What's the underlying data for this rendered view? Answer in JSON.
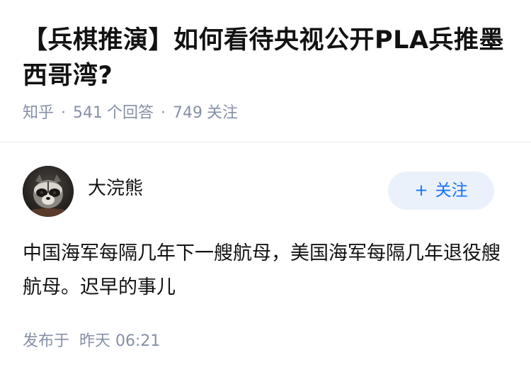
{
  "question": {
    "title": "【兵棋推演】如何看待央视公开PLA兵推墨西哥湾?",
    "source": "知乎",
    "answer_count": "541",
    "answer_label": "个回答",
    "follower_count": "749",
    "follower_label": "关注"
  },
  "author": {
    "name": "大浣熊",
    "avatar_icon": "raccoon-avatar",
    "follow_plus": "+",
    "follow_label": "关注"
  },
  "answer": {
    "content": "中国海军每隔几年下一艘航母，美国海军每隔几年退役艘航母。迟早的事儿",
    "publish_label": "发布于",
    "publish_time": "昨天 06:21"
  },
  "colors": {
    "text": "#121212",
    "meta": "#8590a6",
    "accent": "#1772f6",
    "follow_bg": "#eaf1fb"
  }
}
